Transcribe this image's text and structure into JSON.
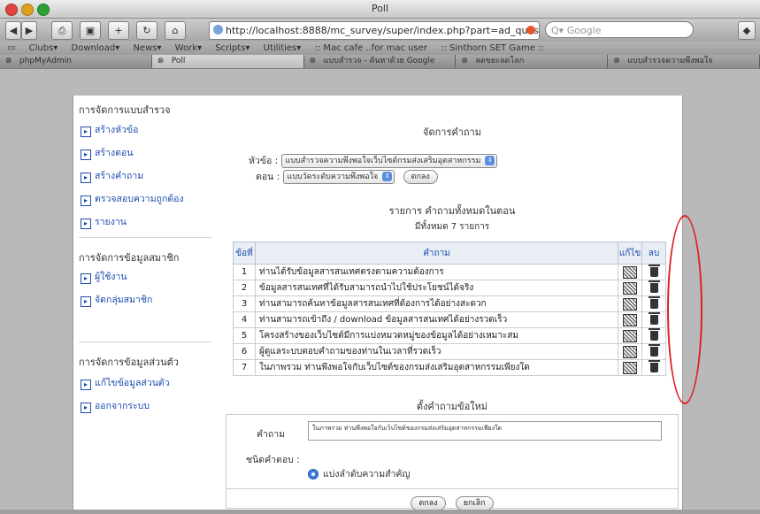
{
  "window": {
    "title": "Poll"
  },
  "toolbar": {
    "url": "http://localhost:8888/mc_survey/super/index.php?part=ad_ques&action=e",
    "search_placeholder": "Google"
  },
  "bookmarks": [
    "Clubs▾",
    "Download▾",
    "News▾",
    "Work▾",
    "Scripts▾",
    "Utilities▾",
    ":: Mac cafe ..for mac user",
    ":: Sinthorn SET Game ::"
  ],
  "tabs": [
    "phpMyAdmin",
    "Poll",
    "แบบสำรวจ - ค้นหาด้วย Google",
    "ลดขยะลดโลก",
    "แบบสำรวจความพึงพอใจ"
  ],
  "sidebar": {
    "survey_section": "การจัดการแบบสำรวจ",
    "survey_links": [
      "สร้างหัวข้อ",
      "สร้างตอน",
      "สร้างคำถาม",
      "ตรวจสอบความถูกต้อง",
      "รายงาน"
    ],
    "member_section": "การจัดการข้อมูลสมาชิก",
    "member_links": [
      "ผู้ใช้งาน",
      "จัดกลุ่มสมาชิก"
    ],
    "personal_section": "การจัดการข้อมูลส่วนตัว",
    "personal_links": [
      "แก้ไขข้อมูลส่วนตัว",
      "ออกจากระบบ"
    ]
  },
  "main": {
    "heading": "จัดการคำถาม",
    "topic_label": "หัวข้อ :",
    "topic_value": "แบบสำรวจความพึงพอใจเว็บไซต์กรมส่งเสริมอุตสาหกรรม",
    "part_label": "ตอน :",
    "part_value": "แบบวัดระดับความพึงพอใจ",
    "ok_button": "ตกลง",
    "list_title": "รายการ คำถามทั้งหมดในตอน",
    "list_count": "มีทั้งหมด 7 รายการ",
    "table": {
      "headers": {
        "num": "ข้อที่",
        "question": "คำถาม",
        "edit": "แก้ไข",
        "delete": "ลบ"
      },
      "rows": [
        {
          "num": "1",
          "question": "ท่านได้รับข้อมูลสารสนเทศตรงตามความต้องการ"
        },
        {
          "num": "2",
          "question": "ข้อมูลสารสนเทศที่ได้รับสามารถนำไปใช้ประโยชน์ได้จริง"
        },
        {
          "num": "3",
          "question": "ท่านสามารถค้นหาข้อมูลสารสนเทศที่ต้องการได้อย่างสะดวก"
        },
        {
          "num": "4",
          "question": "ท่านสามารถเข้าถึง / download ข้อมูลสารสนเทศได้อย่างรวดเร็ว"
        },
        {
          "num": "5",
          "question": "โครงสร้างของเว็บไซต์มีการแบ่งหมวดหมู่ของข้อมูลได้อย่างเหมาะสม"
        },
        {
          "num": "6",
          "question": "ผู้ดูแลระบบตอบคำถามของท่านในเวลาที่รวดเร็ว"
        },
        {
          "num": "7",
          "question": "ในภาพรวม ท่านพึงพอใจกับเว็บไซต์ของกรมส่งเสริมอุตสาหกรรมเพียงใด"
        }
      ]
    },
    "new_title": "ตั้งคำถามข้อใหม่",
    "question_label": "คำถาม",
    "question_value": "ในภาพรวม ท่านพึงพอใจกับเว็บไซต์ของกรมส่งเสริมอุตสาหกรรมเพียงใด",
    "answer_type_label": "ชนิดคำตอบ :",
    "answer_type_value": "แบ่งลำดับความสำคัญ",
    "submit_button": "ตกลง",
    "cancel_button": "ยกเลิก"
  }
}
